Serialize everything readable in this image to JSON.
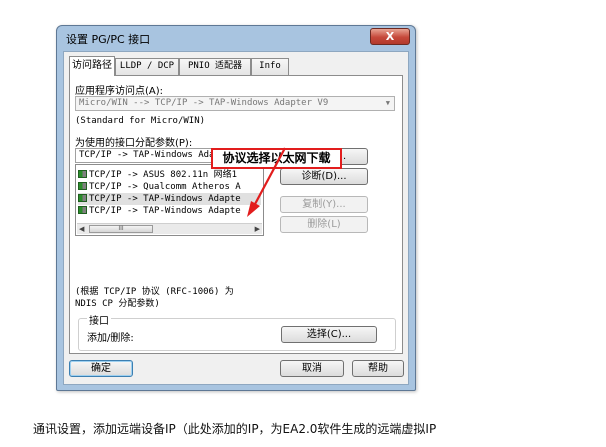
{
  "window": {
    "title": "设置 PG/PC 接口",
    "close_glyph": "X"
  },
  "tabs": [
    {
      "label": "访问路径",
      "active": true
    },
    {
      "label": "LLDP / DCP",
      "active": false
    },
    {
      "label": "PNIO 适配器",
      "active": false
    },
    {
      "label": "Info",
      "active": false
    }
  ],
  "access_path": {
    "app_access_point_label": "应用程序访问点(A):",
    "app_access_point_value": "Micro/WIN        --> TCP/IP -> TAP-Windows Adapter V9",
    "app_access_point_desc": "(Standard for Micro/WIN)",
    "param_label": "为使用的接口分配参数(P):",
    "param_value": "TCP/IP -> TAP-Windows Adapter V9",
    "interfaces": [
      {
        "label": "TCP/IP -> ASUS 802.11n 网络1",
        "selected": false
      },
      {
        "label": "TCP/IP -> Qualcomm Atheros A",
        "selected": false
      },
      {
        "label": "TCP/IP -> TAP-Windows Adapte",
        "selected": true
      },
      {
        "label": "TCP/IP -> TAP-Windows Adapte",
        "selected": false
      }
    ],
    "scroll_left": "◀",
    "scroll_right": "▶",
    "scroll_thumb": "III",
    "note_line1": "(根据 TCP/IP 协议 (RFC-1006) 为",
    "note_line2": "NDIS CP 分配参数)",
    "buttons": {
      "properties": "属性(R)...",
      "diagnostics": "诊断(D)...",
      "copy": "复制(Y)...",
      "delete": "删除(L)"
    }
  },
  "interface_group": {
    "title": "接口",
    "add_remove_label": "添加/删除:",
    "select_button": "选择(C)..."
  },
  "footer": {
    "ok": "确定",
    "cancel": "取消",
    "help": "帮助"
  },
  "annotation": {
    "text": "协议选择以太网下载",
    "color": "#e21d1d"
  },
  "caption": "通讯设置，添加远端设备IP（此处添加的IP，为EA2.0软件生成的远端虚拟IP"
}
